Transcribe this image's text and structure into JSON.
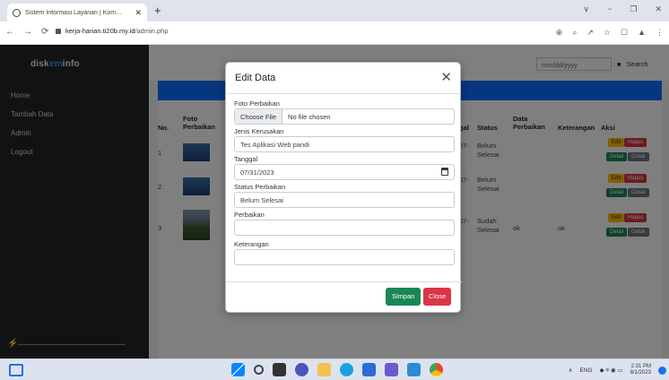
{
  "browser": {
    "tab_title": "Sistem Informasi Layanan | Kom…",
    "new_tab": "+",
    "tab_close": "✕",
    "window_controls": [
      "∨",
      "−",
      "❐",
      "✕"
    ],
    "url_host": "kerja-harian.ti20b.my.id",
    "url_path": "/admin.php",
    "nav": [
      "←",
      "→",
      "⟳"
    ],
    "addr_icons": [
      "⊕",
      "⌕",
      "↗",
      "☆",
      "☐",
      "▲",
      "⋮"
    ]
  },
  "sidebar": {
    "brand_part1": "disk",
    "brand_part2": "em",
    "brand_part3": "info",
    "items": [
      "Home",
      "Tambah Data",
      "Admin",
      "Logout"
    ]
  },
  "topbar": {
    "date_placeholder": "mm/dd/yyyy",
    "search_label": "Search"
  },
  "table": {
    "headers": {
      "no": "No.",
      "foto": "Foto Perbaikan",
      "tanggal": "gal",
      "status": "Status",
      "data": "Data Perbaikan",
      "keterangan": "Keterangan",
      "aksi": "Aksi"
    },
    "rows": [
      {
        "no": "1",
        "tanggal": "07-",
        "status": "Belum Selesai",
        "data": "",
        "keterangan": ""
      },
      {
        "no": "2",
        "tanggal": "07-",
        "status": "Belum Selesai",
        "data": "",
        "keterangan": ""
      },
      {
        "no": "3",
        "tanggal": "07-",
        "status": "Sudah Selesai",
        "data": "ok",
        "keterangan": "ok"
      }
    ],
    "actions": {
      "edit": "Edit",
      "hapus": "Hapus",
      "detail": "Detail",
      "cetak": "Cetak"
    }
  },
  "modal": {
    "title": "Edit Data",
    "close_icon": "✕",
    "fields": {
      "foto_label": "Foto Perbaikan",
      "file_button": "Choose File",
      "file_status": "No file chosen",
      "jenis_label": "Jenis Kerusakan",
      "jenis_value": "Tes Aplikasi Web pandi",
      "tanggal_label": "Tanggal",
      "tanggal_value": "07/31/2023",
      "status_label": "Status Perbaikan",
      "status_value": "Belum Selesai",
      "perbaikan_label": "Perbaikan",
      "perbaikan_value": "",
      "keterangan_label": "Keterangan",
      "keterangan_value": ""
    },
    "buttons": {
      "simpan": "Simpan",
      "close": "Close"
    }
  },
  "taskbar": {
    "tray_lang": "ENG",
    "tray_symbols": "∧",
    "tray_icons": "◆ ≡ ◉ ▭",
    "time": "2:31 PM",
    "date": "8/1/2023"
  }
}
